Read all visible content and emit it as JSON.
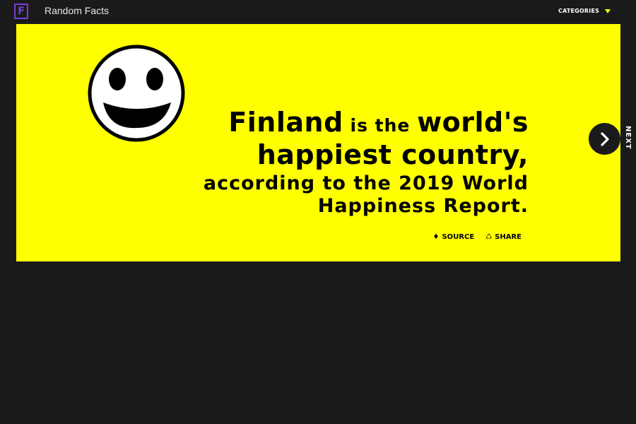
{
  "header": {
    "logo_letter": "F",
    "app_title": "Random Facts",
    "categories_label": "CATEGORIES"
  },
  "fact": {
    "line1_a": "Finland",
    "line1_b": " is the ",
    "line1_c": "world's",
    "line2": "happiest country,",
    "line3": "according to the 2019 World",
    "line4": "Happiness Report."
  },
  "actions": {
    "source_icon": "♦",
    "source_label": "SOURCE",
    "share_icon": "♺",
    "share_label": "SHARE"
  },
  "nav": {
    "next_label": "NEXT"
  },
  "icons": {
    "logo": "brand-logo-icon",
    "smiley": "smiley-face-icon",
    "next": "chevron-right-icon",
    "categories_caret": "caret-down-icon"
  },
  "colors": {
    "background": "#1b1a1b",
    "card": "#ffff00",
    "brand": "#7b3fd6",
    "caret": "#ffff00"
  }
}
